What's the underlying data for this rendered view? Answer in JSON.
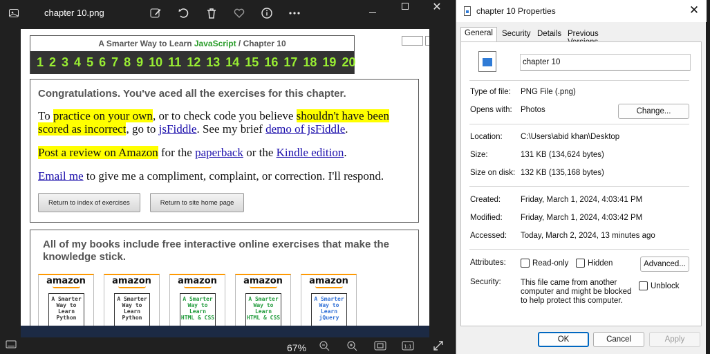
{
  "photos": {
    "filename": "chapter 10.png",
    "zoom": "67%",
    "page": {
      "header_prefix": "A Smarter Way to Learn",
      "header_js": "JavaScript",
      "header_suffix": "/  Chapter 10",
      "chapters": [
        "1",
        "2",
        "3",
        "4",
        "5",
        "6",
        "7",
        "8",
        "9",
        "10",
        "11",
        "12",
        "13",
        "14",
        "15",
        "16",
        "17",
        "18",
        "19",
        "20"
      ],
      "congrats_title": "Congratulations. You've aced all the exercises for this chapter.",
      "p1": {
        "t1": "To ",
        "h1": "practice on your own",
        "t2": ", or to check code you believe ",
        "h2": "shouldn't have been scored as incorrect",
        "t3": ", go to ",
        "l1": "jsFiddle",
        "t4": ". See my brief ",
        "l2": "demo of jsFiddle",
        "t5": "."
      },
      "p2": {
        "h1": "Post a review on Amazon",
        "t1": " for the ",
        "l1": "paperback",
        "t2": " or the ",
        "l2": "Kindle edition",
        "t3": "."
      },
      "p3": {
        "l1": "Email me",
        "t1": " to give me a compliment, complaint, or correction. I'll respond."
      },
      "btn_index": "Return to index of exercises",
      "btn_home": "Return to site home page",
      "books_title": "All of my books include free interactive online exercises that make the knowledge stick.",
      "books": [
        {
          "brand": "amazon",
          "l1": "A Smarter",
          "l2": "Way to",
          "l3": "Learn",
          "l4": "Python",
          "color": "#333333"
        },
        {
          "brand": "amazon",
          "l1": "A Smarter",
          "l2": "Way to",
          "l3": "Learn",
          "l4": "Python",
          "color": "#333333"
        },
        {
          "brand": "amazon",
          "l1": "A Smarter",
          "l2": "Way to",
          "l3": "Learn",
          "l4": "HTML & CSS",
          "color": "#1f9a3a"
        },
        {
          "brand": "amazon",
          "l1": "A Smarter",
          "l2": "Way to",
          "l3": "Learn",
          "l4": "HTML & CSS",
          "color": "#1f9a3a"
        },
        {
          "brand": "amazon",
          "l1": "A Smarter",
          "l2": "Way to",
          "l3": "Learn",
          "l4": "jQuery",
          "color": "#2f6fd6"
        }
      ]
    }
  },
  "props": {
    "title": "chapter 10 Properties",
    "tabs": [
      "General",
      "Security",
      "Details",
      "Previous Versions"
    ],
    "name": "chapter 10",
    "type_label": "Type of file:",
    "type_value": "PNG File (.png)",
    "opens_label": "Opens with:",
    "opens_value": "Photos",
    "change_btn": "Change...",
    "location_label": "Location:",
    "location_value": "C:\\Users\\abid khan\\Desktop",
    "size_label": "Size:",
    "size_value": "131 KB (134,624 bytes)",
    "disk_label": "Size on disk:",
    "disk_value": "132 KB (135,168 bytes)",
    "created_label": "Created:",
    "created_value": "Friday, March 1, 2024, 4:03:41 PM",
    "modified_label": "Modified:",
    "modified_value": "Friday, March 1, 2024, 4:03:42 PM",
    "accessed_label": "Accessed:",
    "accessed_value": "Today, March 2, 2024, 13 minutes ago",
    "attributes_label": "Attributes:",
    "readonly_label": "Read-only",
    "hidden_label": "Hidden",
    "advanced_btn": "Advanced...",
    "security_label": "Security:",
    "security_text": "This file came from another computer and might be blocked to help protect this computer.",
    "unblock_label": "Unblock",
    "ok_btn": "OK",
    "cancel_btn": "Cancel",
    "apply_btn": "Apply"
  }
}
